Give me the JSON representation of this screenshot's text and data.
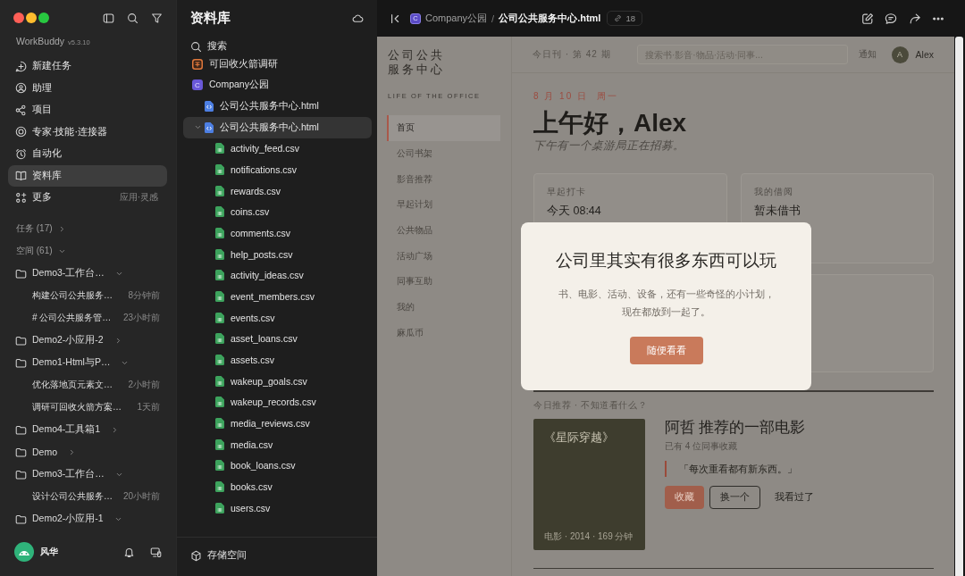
{
  "sidebar": {
    "app_name": "WorkBuddy",
    "version": "v5.3.10",
    "nav": [
      {
        "label": "新建任务",
        "selected": false
      },
      {
        "label": "助理",
        "selected": false
      },
      {
        "label": "项目",
        "selected": false
      },
      {
        "label": "专家·技能·连接器",
        "selected": false
      },
      {
        "label": "自动化",
        "selected": false
      },
      {
        "label": "资料库",
        "selected": true
      },
      {
        "label": "更多",
        "selected": false,
        "note": "应用·灵感"
      }
    ],
    "sections": [
      {
        "label": "任务 (17)",
        "expanded": false
      },
      {
        "label": "空间 (61)",
        "expanded": true,
        "children": [
          {
            "name": "Demo3-工作台…",
            "expanded": true,
            "children": [
              {
                "title": "构建公司公共服务…",
                "time": "8分钟前"
              },
              {
                "title": "# 公司公共服务管…",
                "time": "23小时前"
              }
            ]
          },
          {
            "name": "Demo2-小应用-2",
            "expanded": false
          },
          {
            "name": "Demo1-Html与P…",
            "expanded": true,
            "children": [
              {
                "title": "优化落地页元素文…",
                "time": "2小时前"
              },
              {
                "title": "调研可回收火箭方案…",
                "time": "1天前"
              }
            ]
          },
          {
            "name": "Demo4-工具箱1",
            "expanded": false
          },
          {
            "name": "Demo",
            "expanded": false
          },
          {
            "name": "Demo3-工作台…",
            "expanded": true,
            "children": [
              {
                "title": "设计公司公共服务…",
                "time": "20小时前"
              }
            ]
          },
          {
            "name": "Demo2-小应用-1",
            "expanded": true
          }
        ]
      }
    ],
    "user": {
      "name": "风华"
    }
  },
  "library": {
    "title": "资料库",
    "search": "搜索",
    "items": [
      {
        "name": "可回收火箭调研",
        "kind": "project",
        "color": "#e0783c",
        "selected": false
      },
      {
        "name": "Company公园",
        "kind": "project",
        "color": "#6a58d8",
        "initial": "C",
        "selected": false,
        "children": [
          {
            "name": "公司公共服务中心.html",
            "kind": "html",
            "selected": false
          },
          {
            "name": "公司公共服务中心.html",
            "kind": "html",
            "selected": true,
            "expanded": true,
            "children": [
              {
                "name": "activity_feed.csv",
                "kind": "csv",
                "selected": false
              },
              {
                "name": "notifications.csv",
                "kind": "csv",
                "selected": false
              },
              {
                "name": "rewards.csv",
                "kind": "csv",
                "selected": false
              },
              {
                "name": "coins.csv",
                "kind": "csv",
                "selected": false
              },
              {
                "name": "comments.csv",
                "kind": "csv",
                "selected": false
              },
              {
                "name": "help_posts.csv",
                "kind": "csv",
                "selected": false
              },
              {
                "name": "activity_ideas.csv",
                "kind": "csv",
                "selected": false
              },
              {
                "name": "event_members.csv",
                "kind": "csv",
                "selected": false
              },
              {
                "name": "events.csv",
                "kind": "csv",
                "selected": false
              },
              {
                "name": "asset_loans.csv",
                "kind": "csv",
                "selected": false
              },
              {
                "name": "assets.csv",
                "kind": "csv",
                "selected": false
              },
              {
                "name": "wakeup_goals.csv",
                "kind": "csv",
                "selected": false
              },
              {
                "name": "wakeup_records.csv",
                "kind": "csv",
                "selected": false
              },
              {
                "name": "media_reviews.csv",
                "kind": "csv",
                "selected": false
              },
              {
                "name": "media.csv",
                "kind": "csv",
                "selected": false
              },
              {
                "name": "book_loans.csv",
                "kind": "csv",
                "selected": false
              },
              {
                "name": "books.csv",
                "kind": "csv",
                "selected": false
              },
              {
                "name": "users.csv",
                "kind": "csv",
                "selected": false
              }
            ]
          }
        ]
      }
    ],
    "footer": "存储空间"
  },
  "topbar": {
    "project": {
      "name": "Company公园",
      "initial": "C"
    },
    "separator": "/",
    "file": "公司公共服务中心.html",
    "count": "18"
  },
  "preview": {
    "brand": "公司公共服务中心",
    "tagline": "LIFE OF THE OFFICE",
    "nav": [
      {
        "label": "首页",
        "selected": true
      },
      {
        "label": "公司书架",
        "selected": false
      },
      {
        "label": "影音推荐",
        "selected": false
      },
      {
        "label": "早起计划",
        "selected": false
      },
      {
        "label": "公共物品",
        "selected": false
      },
      {
        "label": "活动广场",
        "selected": false
      },
      {
        "label": "同事互助",
        "selected": false
      },
      {
        "label": "我的",
        "selected": false
      },
      {
        "label": "麻瓜币",
        "selected": false
      }
    ],
    "issue": "今日刊 · 第 42 期",
    "search": {
      "placeholder": "搜索书·影音·物品·活动·同事..."
    },
    "notice": "通知",
    "user": {
      "initial": "A",
      "name": "Alex"
    },
    "date": "8 月 10 日",
    "weekday": "周一",
    "greeting": "上午好，Alex",
    "subtitle": "下午有一个桌游局正在招募。",
    "cards": [
      {
        "label": "早起打卡",
        "value": "今天 08:44"
      },
      {
        "label": "我的借阅",
        "value": "暂未借书"
      }
    ],
    "recommend": {
      "heading": "今日推荐 · 不知道看什么？",
      "poster_title": "《星际穿越》",
      "poster_meta": "电影 · 2014 · 169 分钟",
      "title": "阿哲 推荐的一部电影",
      "saved": "已有 4 位同事收藏",
      "quote": "「每次重看都有新东西。」",
      "actions": [
        {
          "label": "收藏",
          "kind": "primary"
        },
        {
          "label": "换一个",
          "kind": "outline"
        },
        {
          "label": "我看过了",
          "kind": "text"
        }
      ]
    }
  },
  "modal": {
    "title": "公司里其实有很多东西可以玩",
    "body": "书、电影、活动、设备，还有一些奇怪的小计划，现在都放到一起了。",
    "button": "随便看看"
  }
}
